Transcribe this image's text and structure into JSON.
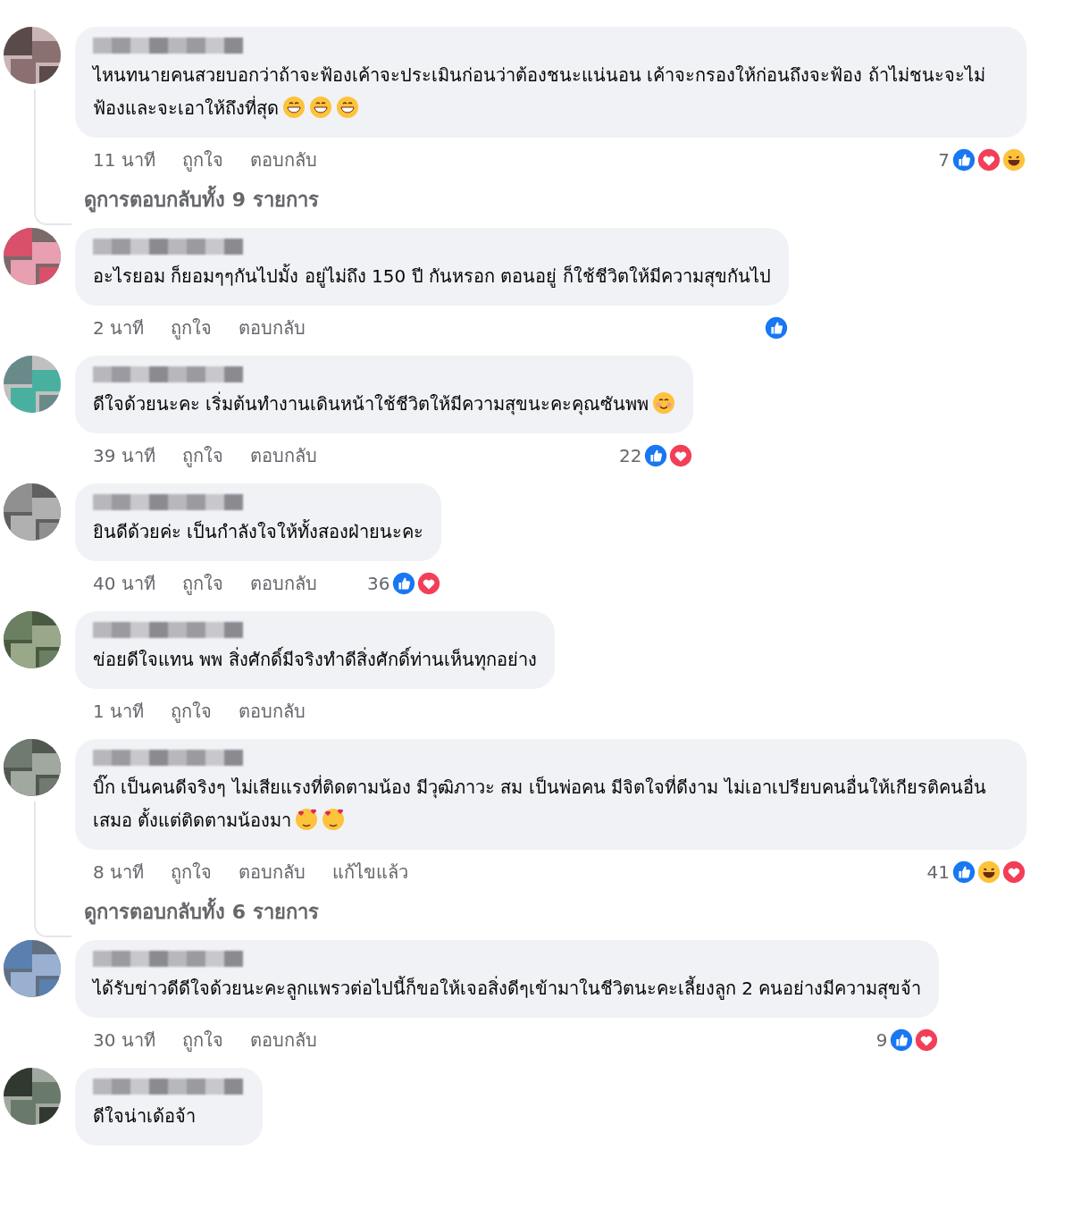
{
  "comments": [
    {
      "text": "ไหนทนายคนสวยบอกว่าถ้าจะฟ้องเค้าจะประเมินก่อนว่าต้องชนะแน่นอน เค้าจะกรองให้ก่อนถึงจะฟ้อง ถ้าไม่ชนะจะไม่ฟ้องและจะเอาให้ถึงที่สุด",
      "emojis": [
        {
          "kind": "grin"
        },
        {
          "kind": "grin"
        },
        {
          "kind": "grin"
        }
      ],
      "time": "11 นาที",
      "like": "ถูกใจ",
      "reply": "ตอบกลับ",
      "reaction_count": "7",
      "reactions": [
        {
          "kind": "like"
        },
        {
          "kind": "love"
        },
        {
          "kind": "haha"
        }
      ],
      "replies_link": "ดูการตอบกลับทั้ง 9 รายการ"
    },
    {
      "text": "อะไรยอม ก็ยอมๆๆกันไปมั้ง อยู่ไม่ถึง 150 ปี กันหรอก ตอนอยู่ ก็ใช้ชีวิตให้มีความสุขกันไป",
      "time": "2 นาที",
      "like": "ถูกใจ",
      "reply": "ตอบกลับ",
      "reactions": [
        {
          "kind": "like"
        }
      ]
    },
    {
      "text": "ดีใจด้วยนะคะ เริ่มต้นทำงานเดินหน้าใช้ชีวิตให้มีความสุขนะคะคุณซันพพ",
      "emojis": [
        {
          "kind": "blush"
        }
      ],
      "time": "39 นาที",
      "like": "ถูกใจ",
      "reply": "ตอบกลับ",
      "reaction_count": "22",
      "reactions": [
        {
          "kind": "like"
        },
        {
          "kind": "love"
        }
      ]
    },
    {
      "text": "ยินดีด้วยค่ะ เป็นกำลังใจให้ทั้งสองฝ่ายนะคะ",
      "time": "40 นาที",
      "like": "ถูกใจ",
      "reply": "ตอบกลับ",
      "reaction_count": "36",
      "reactions": [
        {
          "kind": "like"
        },
        {
          "kind": "love"
        }
      ]
    },
    {
      "text": "ข่อยดีใจแทน พพ สิ่งศักดิ์มีจริงทำดีสิ่งศักดิ์ท่านเห็นทุกอย่าง",
      "time": "1 นาที",
      "like": "ถูกใจ",
      "reply": "ตอบกลับ"
    },
    {
      "text": "บิ๊ก เป็นคนดีจริงๆ ไม่เสียแรงที่ติดตามน้อง มีวุฒิภาวะ สม เป็นพ่อคน มีจิตใจที่ดีงาม ไม่เอาเปรียบคนอื่นให้เกียรติคนอื่นเสมอ ตั้งแต่ติดตามน้องมา",
      "emojis": [
        {
          "kind": "hearts"
        },
        {
          "kind": "hearts"
        }
      ],
      "time": "8 นาที",
      "like": "ถูกใจ",
      "reply": "ตอบกลับ",
      "edited": "แก้ไขแล้ว",
      "reaction_count": "41",
      "reactions": [
        {
          "kind": "like"
        },
        {
          "kind": "haha"
        },
        {
          "kind": "love"
        }
      ],
      "replies_link": "ดูการตอบกลับทั้ง 6 รายการ"
    },
    {
      "text": "ได้รับข่าวดีดีใจด้วยนะคะลูกแพรวต่อไปนี้ก็ขอให้เจอสิ่งดีๆเข้ามาในชีวิตนะคะเลี้ยงลูก 2 คนอย่างมีความสุขจ้า",
      "time": "30 นาที",
      "like": "ถูกใจ",
      "reply": "ตอบกลับ",
      "reaction_count": "9",
      "reactions": [
        {
          "kind": "like"
        },
        {
          "kind": "love"
        }
      ]
    },
    {
      "text": "ดีใจน่าเด้อจ้า"
    }
  ]
}
